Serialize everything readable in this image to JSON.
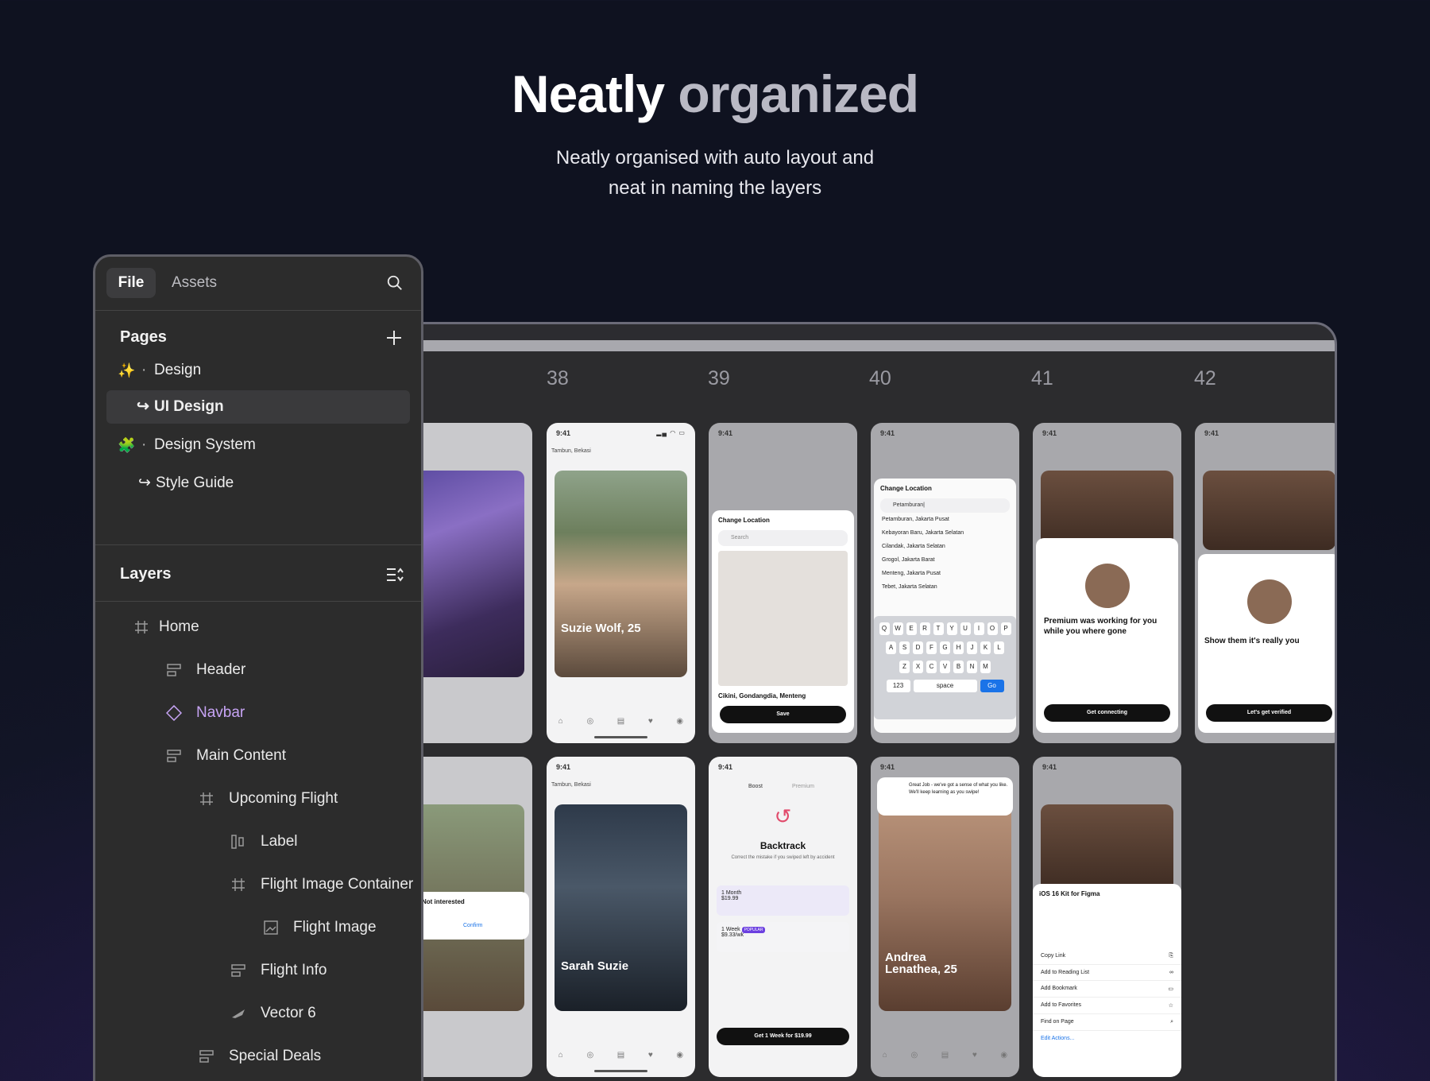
{
  "hero": {
    "title_a": "Neatly",
    "title_b": "organized",
    "subtitle_line1": "Neatly organised with auto layout and",
    "subtitle_line2": "neat in naming the layers"
  },
  "panel": {
    "tabs": {
      "file": "File",
      "assets": "Assets"
    },
    "pages_title": "Pages",
    "pages": [
      {
        "label": "Design",
        "emoji": "✨"
      },
      {
        "label": "UI Design",
        "prefix": "↪"
      },
      {
        "label": "Design System",
        "emoji": "🧩"
      },
      {
        "label": "Style Guide",
        "prefix": "↪"
      }
    ],
    "layers_title": "Layers",
    "layers": [
      {
        "label": "Home",
        "icon": "frame-icon"
      },
      {
        "label": "Header",
        "icon": "auto-layout-icon"
      },
      {
        "label": "Navbar",
        "icon": "component-instance-icon"
      },
      {
        "label": "Main Content",
        "icon": "auto-layout-icon"
      },
      {
        "label": "Upcoming Flight",
        "icon": "frame-icon"
      },
      {
        "label": "Label",
        "icon": "auto-layout-horizontal-icon"
      },
      {
        "label": "Flight Image Container",
        "icon": "frame-icon"
      },
      {
        "label": "Flight Image",
        "icon": "image-icon"
      },
      {
        "label": "Flight Info",
        "icon": "auto-layout-icon"
      },
      {
        "label": "Vector 6",
        "icon": "vector-icon"
      },
      {
        "label": "Special Deals",
        "icon": "auto-layout-icon"
      }
    ]
  },
  "canvas": {
    "frame_numbers": [
      "38",
      "39",
      "40",
      "41",
      "42"
    ],
    "phones": {
      "time": "9:41",
      "location": "Tambun, Bekasi",
      "names": [
        "Suzie Wolf, 25",
        "Sarah Suzie",
        "Andrea Lenathea, 25"
      ],
      "change_location_title": "Change Location",
      "search_placeholder": "Search",
      "search_value": "Petamburan|",
      "save_label": "Save",
      "map_address": "Cikini, Gondangdia, Menteng",
      "results": [
        "Petamburan, Jakarta Pusat",
        "Kebayoran Baru, Jakarta Selatan",
        "Cilandak, Jakarta Selatan",
        "Grogol, Jakarta Barat",
        "Menteng, Jakarta Pusat",
        "Tebet, Jakarta Selatan"
      ],
      "keyboard_row1": [
        "Q",
        "W",
        "E",
        "R",
        "T",
        "Y",
        "U",
        "I",
        "O",
        "P"
      ],
      "keyboard_row2": [
        "A",
        "S",
        "D",
        "F",
        "G",
        "H",
        "J",
        "K",
        "L"
      ],
      "keyboard_row3": [
        "Z",
        "X",
        "C",
        "V",
        "B",
        "N",
        "M"
      ],
      "keyboard_123": "123",
      "keyboard_space": "space",
      "keyboard_go": "Go",
      "premium_text": "Premium was working for you while you where gone",
      "get_connecting": "Get connecting",
      "show_them": "Show them it's really you",
      "lets_get_verified": "Let's get verified",
      "not_interested": "Not interested",
      "confirm": "Confirm",
      "backtrack_title": "Backtrack",
      "backtrack_sub": "Correct the mistake if you swiped left by accident",
      "boost_tab": "Boost",
      "premium_tab": "Premium",
      "plan1": "1 Month",
      "plan1_price": "$19.99",
      "plan2": "1 Week",
      "plan2_badge": "POPULAR",
      "plan2_price": "$9.33/wk",
      "get_week": "Get 1 Week for $19.99",
      "great_job": "Great Job - we've got a sense of what you like. We'll keep learning as you swipe!",
      "share_title": "iOS 16 Kit for Figma",
      "share_items": [
        "Copy Link",
        "Add to Reading List",
        "Add Bookmark",
        "Add to Favorites",
        "Find on Page"
      ],
      "edit_actions": "Edit Actions..."
    }
  }
}
